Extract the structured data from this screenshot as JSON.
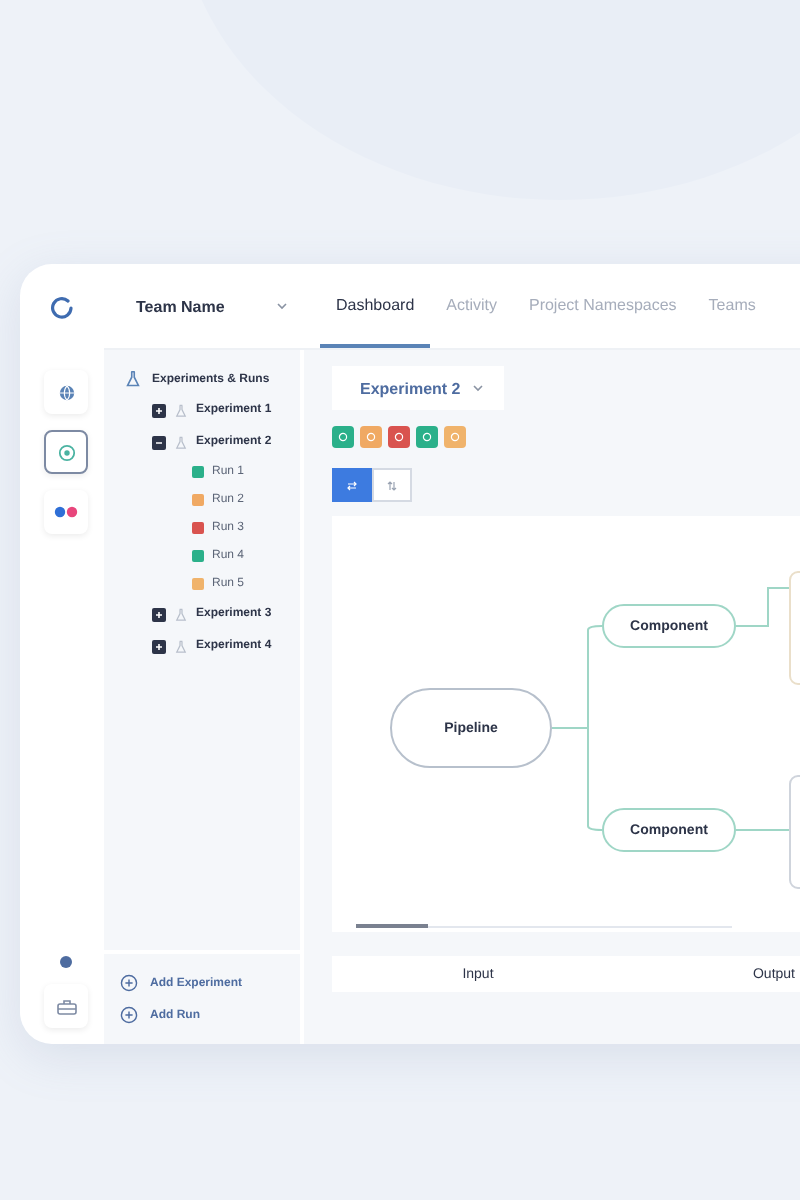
{
  "header": {
    "team": "Team Name"
  },
  "tabs": [
    {
      "label": "Dashboard",
      "selected": true
    },
    {
      "label": "Activity",
      "selected": false
    },
    {
      "label": "Project Namespaces",
      "selected": false
    },
    {
      "label": "Teams",
      "selected": false
    }
  ],
  "rail": [
    {
      "selected": false
    },
    {
      "selected": true
    },
    {
      "selected": false
    }
  ],
  "tree": {
    "title": "Experiments & Runs",
    "experiments": [
      {
        "name": "Experiment 1",
        "expanded": false
      },
      {
        "name": "Experiment 2",
        "expanded": true,
        "children": [
          {
            "name": "Run 1",
            "color": "#2bb08a"
          },
          {
            "name": "Run 2",
            "color": "#f0a963"
          },
          {
            "name": "Run 3",
            "color": "#d9534f"
          },
          {
            "name": "Run 4",
            "color": "#2bb08a"
          },
          {
            "name": "Run 5",
            "color": "#f0b36b"
          }
        ]
      },
      {
        "name": "Experiment 3",
        "expanded": false
      },
      {
        "name": "Experiment 4",
        "expanded": false
      }
    ]
  },
  "actions": [
    "Add Experiment",
    "Add Run"
  ],
  "experiment_select": {
    "value": "Experiment 2"
  },
  "status_chips": [
    {
      "color": "#2bb08a"
    },
    {
      "color": "#f0a963"
    },
    {
      "color": "#d9534f"
    },
    {
      "color": "#2bb08a"
    },
    {
      "color": "#f0b36b"
    }
  ],
  "view_toggle": [
    {
      "selected": true
    },
    {
      "selected": false
    }
  ],
  "diagram": {
    "nodes": [
      {
        "label": "Pipeline",
        "kind": "root"
      },
      {
        "label": "Component",
        "kind": "component"
      },
      {
        "label": "Component",
        "kind": "component"
      }
    ]
  },
  "columns": [
    "Input",
    "Output"
  ]
}
